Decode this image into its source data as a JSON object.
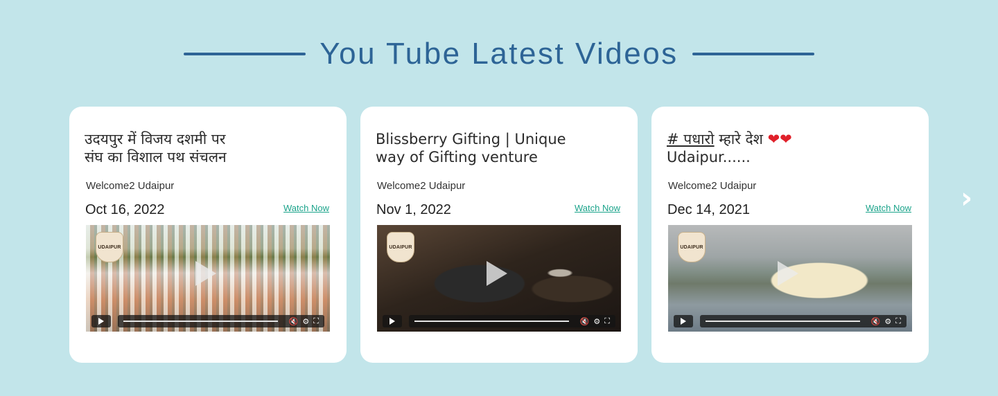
{
  "heading": {
    "title": "You Tube Latest Videos"
  },
  "cards": [
    {
      "title_line1": "उदयपुर में विजय दशमी पर",
      "title_line2": "संघ का विशाल पथ संचलन",
      "channel": "Welcome2 Udaipur",
      "date": "Oct 16, 2022",
      "watch_label": "Watch Now"
    },
    {
      "title_line1": "Blissberry Gifting | Unique",
      "title_line2": "way of Gifting venture",
      "channel": "Welcome2 Udaipur",
      "date": "Nov 1, 2022",
      "watch_label": "Watch Now"
    },
    {
      "title_hash": "# पधारो",
      "title_rest": " म्हारे देश ",
      "title_hearts": "❤❤",
      "title_line2": "Udaipur......",
      "channel": "Welcome2 Udaipur",
      "date": "Dec 14, 2021",
      "watch_label": "Watch Now"
    }
  ],
  "logo_text": "UDAIPUR",
  "carousel": {
    "next_icon": "chevron-right-icon"
  },
  "colors": {
    "background": "#c2e5ea",
    "heading": "#2d6496",
    "link": "#1aa38a"
  }
}
